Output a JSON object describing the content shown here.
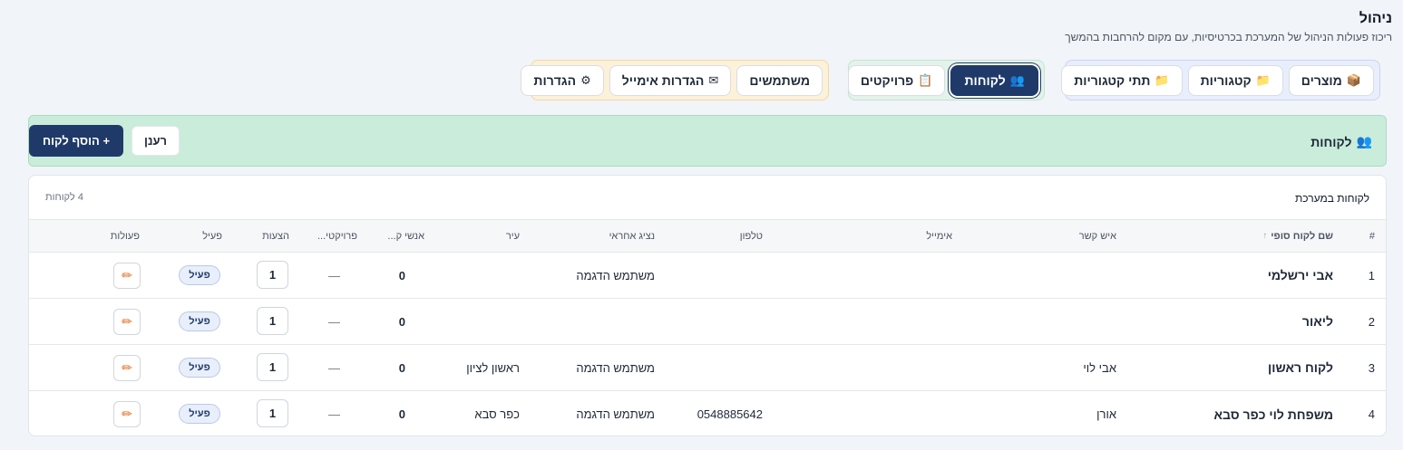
{
  "header": {
    "title": "ניהול",
    "subtitle": "ריכוז פעולות הניהול של המערכת בכרטיסיות, עם מקום להרחבות בהמשך"
  },
  "nav": {
    "blue": [
      {
        "label": "מוצרים",
        "icon": "📦"
      },
      {
        "label": "קטגוריות",
        "icon": "📁"
      },
      {
        "label": "תתי קטגוריות",
        "icon": "📁"
      }
    ],
    "green": [
      {
        "label": "לקוחות",
        "icon": "👥",
        "active": true
      },
      {
        "label": "פרויקטים",
        "icon": "📋"
      }
    ],
    "yellow": [
      {
        "label": "משתמשים",
        "icon": ""
      },
      {
        "label": "הגדרות אימייל",
        "icon": "✉"
      },
      {
        "label": "הגדרות",
        "icon": "⚙"
      }
    ]
  },
  "banner": {
    "title": "לקוחות",
    "icon": "👥",
    "add_label": "+ הוסף לקוח",
    "refresh_label": "רענן"
  },
  "card": {
    "title": "לקוחות במערכת",
    "count": "4 לקוחות"
  },
  "table": {
    "columns": {
      "idx": "#",
      "name": "שם לקוח סופי",
      "contact": "איש קשר",
      "email": "אימייל",
      "phone": "טלפון",
      "rep": "נציג אחראי",
      "city": "עיר",
      "people": "אנשי ק...",
      "projects": "פרויקטי...",
      "quotes": "הצעות",
      "active": "פעיל",
      "actions": "פעולות",
      "sort_indicator": "↑"
    },
    "rows": [
      {
        "idx": "1",
        "name": "אבי ירשלמי",
        "contact": "",
        "email": "",
        "phone": "",
        "rep": "משתמש הדגמה",
        "city": "",
        "people": "0",
        "projects": "—",
        "quotes": "1",
        "active": "פעיל"
      },
      {
        "idx": "2",
        "name": "ליאור",
        "contact": "",
        "email": "",
        "phone": "",
        "rep": "",
        "city": "",
        "people": "0",
        "projects": "—",
        "quotes": "1",
        "active": "פעיל"
      },
      {
        "idx": "3",
        "name": "לקוח ראשון",
        "contact": "אבי לוי",
        "email": "",
        "phone": "",
        "rep": "משתמש הדגמה",
        "city": "ראשון לציון",
        "people": "0",
        "projects": "—",
        "quotes": "1",
        "active": "פעיל"
      },
      {
        "idx": "4",
        "name": "משפחת לוי כפר סבא",
        "contact": "אורן",
        "email": "",
        "phone": "0548885642",
        "rep": "משתמש הדגמה",
        "city": "כפר סבא",
        "people": "0",
        "projects": "—",
        "quotes": "1",
        "active": "פעיל"
      }
    ]
  },
  "colors": {
    "primary": "#1f3a68",
    "banner_bg": "#c9ecdb",
    "edit_icon": "#e0691e"
  }
}
